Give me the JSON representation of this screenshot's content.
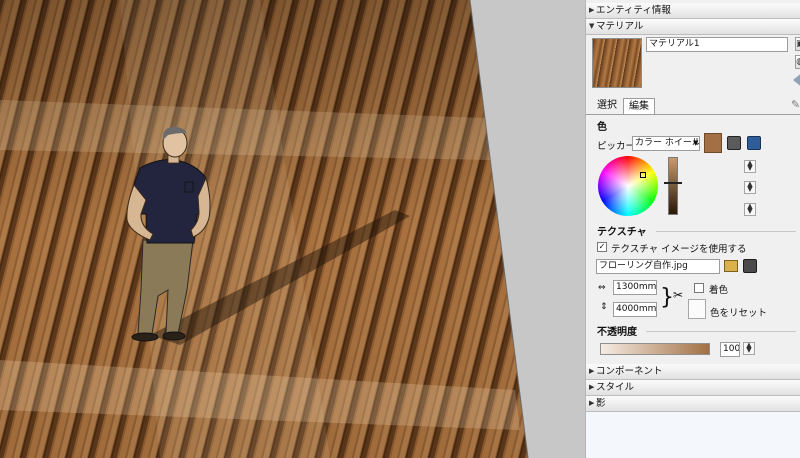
{
  "panels": {
    "entity_info": "エンティティ情報",
    "material": "マテリアル",
    "components": "コンポーネント",
    "styles": "スタイル",
    "shadows": "影"
  },
  "material": {
    "name": "マテリアル1",
    "tabs": [
      "選択",
      "編集"
    ]
  },
  "color": {
    "section": "色",
    "picker_label": "ピッカー:",
    "picker_value": "カラー ホイール",
    "swatch": "#a27044"
  },
  "texture": {
    "section": "テクスチャ",
    "use_image_label": "テクスチャ イメージを使用する",
    "use_image_checked": "✓",
    "file_name": "フローリング自作.jpg",
    "width": "1300mm",
    "height": "4000mm",
    "colorize_label": "着色",
    "reset_color_label": "色をリセット"
  },
  "opacity": {
    "section": "不透明度",
    "value": "100"
  }
}
